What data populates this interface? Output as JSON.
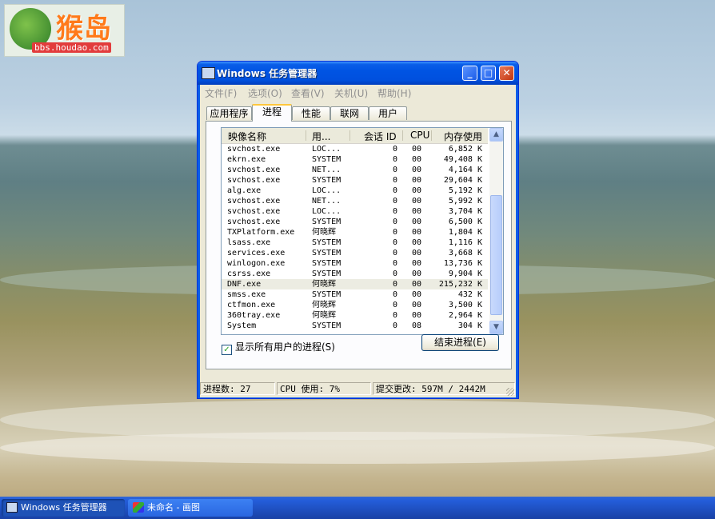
{
  "watermark": {
    "brand": "猴岛",
    "url": "bbs.houdao.com"
  },
  "window": {
    "title": "Windows 任务管理器",
    "controls": {
      "minimize": "_",
      "maximize": "□",
      "close": "✕"
    },
    "menu": [
      "文件(F)",
      "选项(O)",
      "查看(V)",
      "关机(U)",
      "帮助(H)"
    ],
    "tabs": [
      "应用程序",
      "进程",
      "性能",
      "联网",
      "用户"
    ],
    "active_tab": "进程",
    "columns": [
      "映像名称",
      "用...",
      "会话 ID",
      "CPU",
      "内存使用"
    ],
    "processes": [
      [
        "svchost.exe",
        "LOC...",
        "0",
        "00",
        "6,852 K"
      ],
      [
        "ekrn.exe",
        "SYSTEM",
        "0",
        "00",
        "49,408 K"
      ],
      [
        "svchost.exe",
        "NET...",
        "0",
        "00",
        "4,164 K"
      ],
      [
        "svchost.exe",
        "SYSTEM",
        "0",
        "00",
        "29,604 K"
      ],
      [
        "alg.exe",
        "LOC...",
        "0",
        "00",
        "5,192 K"
      ],
      [
        "svchost.exe",
        "NET...",
        "0",
        "00",
        "5,992 K"
      ],
      [
        "svchost.exe",
        "LOC...",
        "0",
        "00",
        "3,704 K"
      ],
      [
        "svchost.exe",
        "SYSTEM",
        "0",
        "00",
        "6,500 K"
      ],
      [
        "TXPlatform.exe",
        "何晓辉",
        "0",
        "00",
        "1,804 K"
      ],
      [
        "lsass.exe",
        "SYSTEM",
        "0",
        "00",
        "1,116 K"
      ],
      [
        "services.exe",
        "SYSTEM",
        "0",
        "00",
        "3,668 K"
      ],
      [
        "winlogon.exe",
        "SYSTEM",
        "0",
        "00",
        "13,736 K"
      ],
      [
        "csrss.exe",
        "SYSTEM",
        "0",
        "00",
        "9,904 K"
      ],
      [
        "DNF.exe",
        "何晓辉",
        "0",
        "00",
        "215,232 K"
      ],
      [
        "smss.exe",
        "SYSTEM",
        "0",
        "00",
        "432 K"
      ],
      [
        "ctfmon.exe",
        "何晓辉",
        "0",
        "00",
        "3,500 K"
      ],
      [
        "360tray.exe",
        "何晓辉",
        "0",
        "00",
        "2,964 K"
      ],
      [
        "System",
        "SYSTEM",
        "0",
        "08",
        "304 K"
      ]
    ],
    "selected_process": "DNF.exe",
    "show_all_users": {
      "label": "显示所有用户的进程(S)",
      "checked": true
    },
    "end_process_button": "结束进程(E)",
    "status": {
      "processes": "进程数: 27",
      "cpu": "CPU 使用: 7%",
      "commit": "提交更改: 597M / 2442M"
    }
  },
  "taskbar": {
    "items": [
      {
        "label": "Windows 任务管理器",
        "icon": "task-manager-icon",
        "active": true
      },
      {
        "label": "未命名 - 画图",
        "icon": "paint-icon",
        "active": false
      }
    ]
  },
  "colors": {
    "titlebar": "#0054e3",
    "taskbar": "#245edb",
    "window_bg": "#ece9d8",
    "selection": "#ecece2"
  }
}
